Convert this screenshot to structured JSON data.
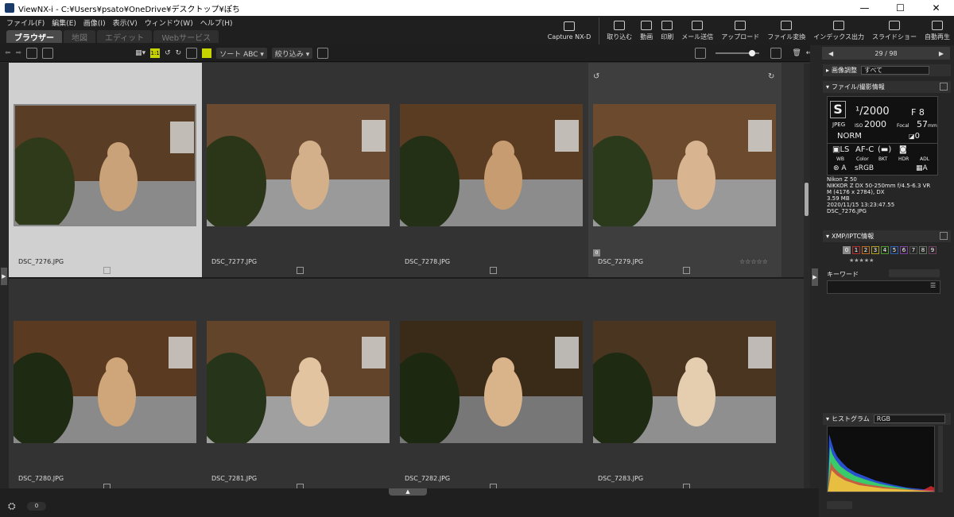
{
  "window": {
    "title": "ViewNX-i - C:¥Users¥psato¥OneDrive¥デスクトップ¥ぽち",
    "minimize": "—",
    "maximize": "☐",
    "close": "✕"
  },
  "menu": [
    "ファイル(F)",
    "編集(E)",
    "画像(I)",
    "表示(V)",
    "ウィンドウ(W)",
    "ヘルプ(H)"
  ],
  "tabs": [
    {
      "label": "ブラウザー",
      "active": true
    },
    {
      "label": "地図",
      "active": false
    },
    {
      "label": "エディット",
      "active": false
    },
    {
      "label": "Webサービス",
      "active": false
    }
  ],
  "ribbon": [
    "Capture NX-D",
    "取り込む",
    "動画",
    "印刷",
    "メール送信",
    "アップロード",
    "ファイル変換",
    "インデックス出力",
    "スライドショー",
    "自動再生"
  ],
  "toolbar": {
    "sort": "ソート ABC ▾",
    "filter": "絞り込み ▾",
    "one_to_one": "1:1"
  },
  "thumbnails": [
    {
      "filename": "DSC_7276.JPG",
      "selected": true
    },
    {
      "filename": "DSC_7277.JPG",
      "selected": false
    },
    {
      "filename": "DSC_7278.JPG",
      "selected": false
    },
    {
      "filename": "DSC_7279.JPG",
      "selected": false,
      "hover": true
    },
    {
      "filename": "DSC_7280.JPG",
      "selected": false
    },
    {
      "filename": "DSC_7281.JPG",
      "selected": false
    },
    {
      "filename": "DSC_7282.JPG",
      "selected": false
    },
    {
      "filename": "DSC_7283.JPG",
      "selected": false
    }
  ],
  "hover_rating": "☆☆☆☆☆",
  "hover_label_box": "0",
  "bottom": {
    "count": "0"
  },
  "panel": {
    "nav_prev": "◀",
    "nav_next": "▶",
    "position": "29 / 98",
    "adjust_label": "画像調整",
    "adjust_value": "すべて",
    "file_info_title": "ファイル/撮影情報",
    "shooting": {
      "mode": "S",
      "shutter": "¹/2000",
      "aperture": "F 8",
      "format": "JPEG",
      "iso_label": "ISO",
      "iso": "2000",
      "focal_label": "Focal",
      "focal": "57",
      "focal_unit": "mm",
      "quality": "NORM",
      "exposure_comp": "0",
      "metering": "LS",
      "af": "AF-C",
      "wb": "WB",
      "color": "Color",
      "bkt": "BKT",
      "hdr": "HDR",
      "adl": "ADL",
      "wb_value": "A",
      "color_value": "sRGB",
      "adl_value": "A"
    },
    "camera_info": [
      "Nikon Z 50",
      "NIKKOR Z DX 50-250mm f/4.5-6.3 VR",
      "M (4176 x 2784), DX",
      "3.59 MB",
      "2020/11/15 13:23:47.55",
      "DSC_7276.JPG"
    ],
    "xmp_title": "XMP/IPTC情報",
    "labels": [
      "0",
      "1",
      "2",
      "3",
      "4",
      "5",
      "6",
      "7",
      "8",
      "9"
    ],
    "label_colors": [
      "#8a8a8a",
      "#b03030",
      "#c06a20",
      "#b0a020",
      "#4a9a30",
      "#3060b0",
      "#8040a0",
      "#505050",
      "#607060",
      "#704060"
    ],
    "rating": "★★★★★",
    "keyword_label": "キーワード",
    "histogram_title": "ヒストグラム",
    "histogram_channel": "RGB"
  }
}
